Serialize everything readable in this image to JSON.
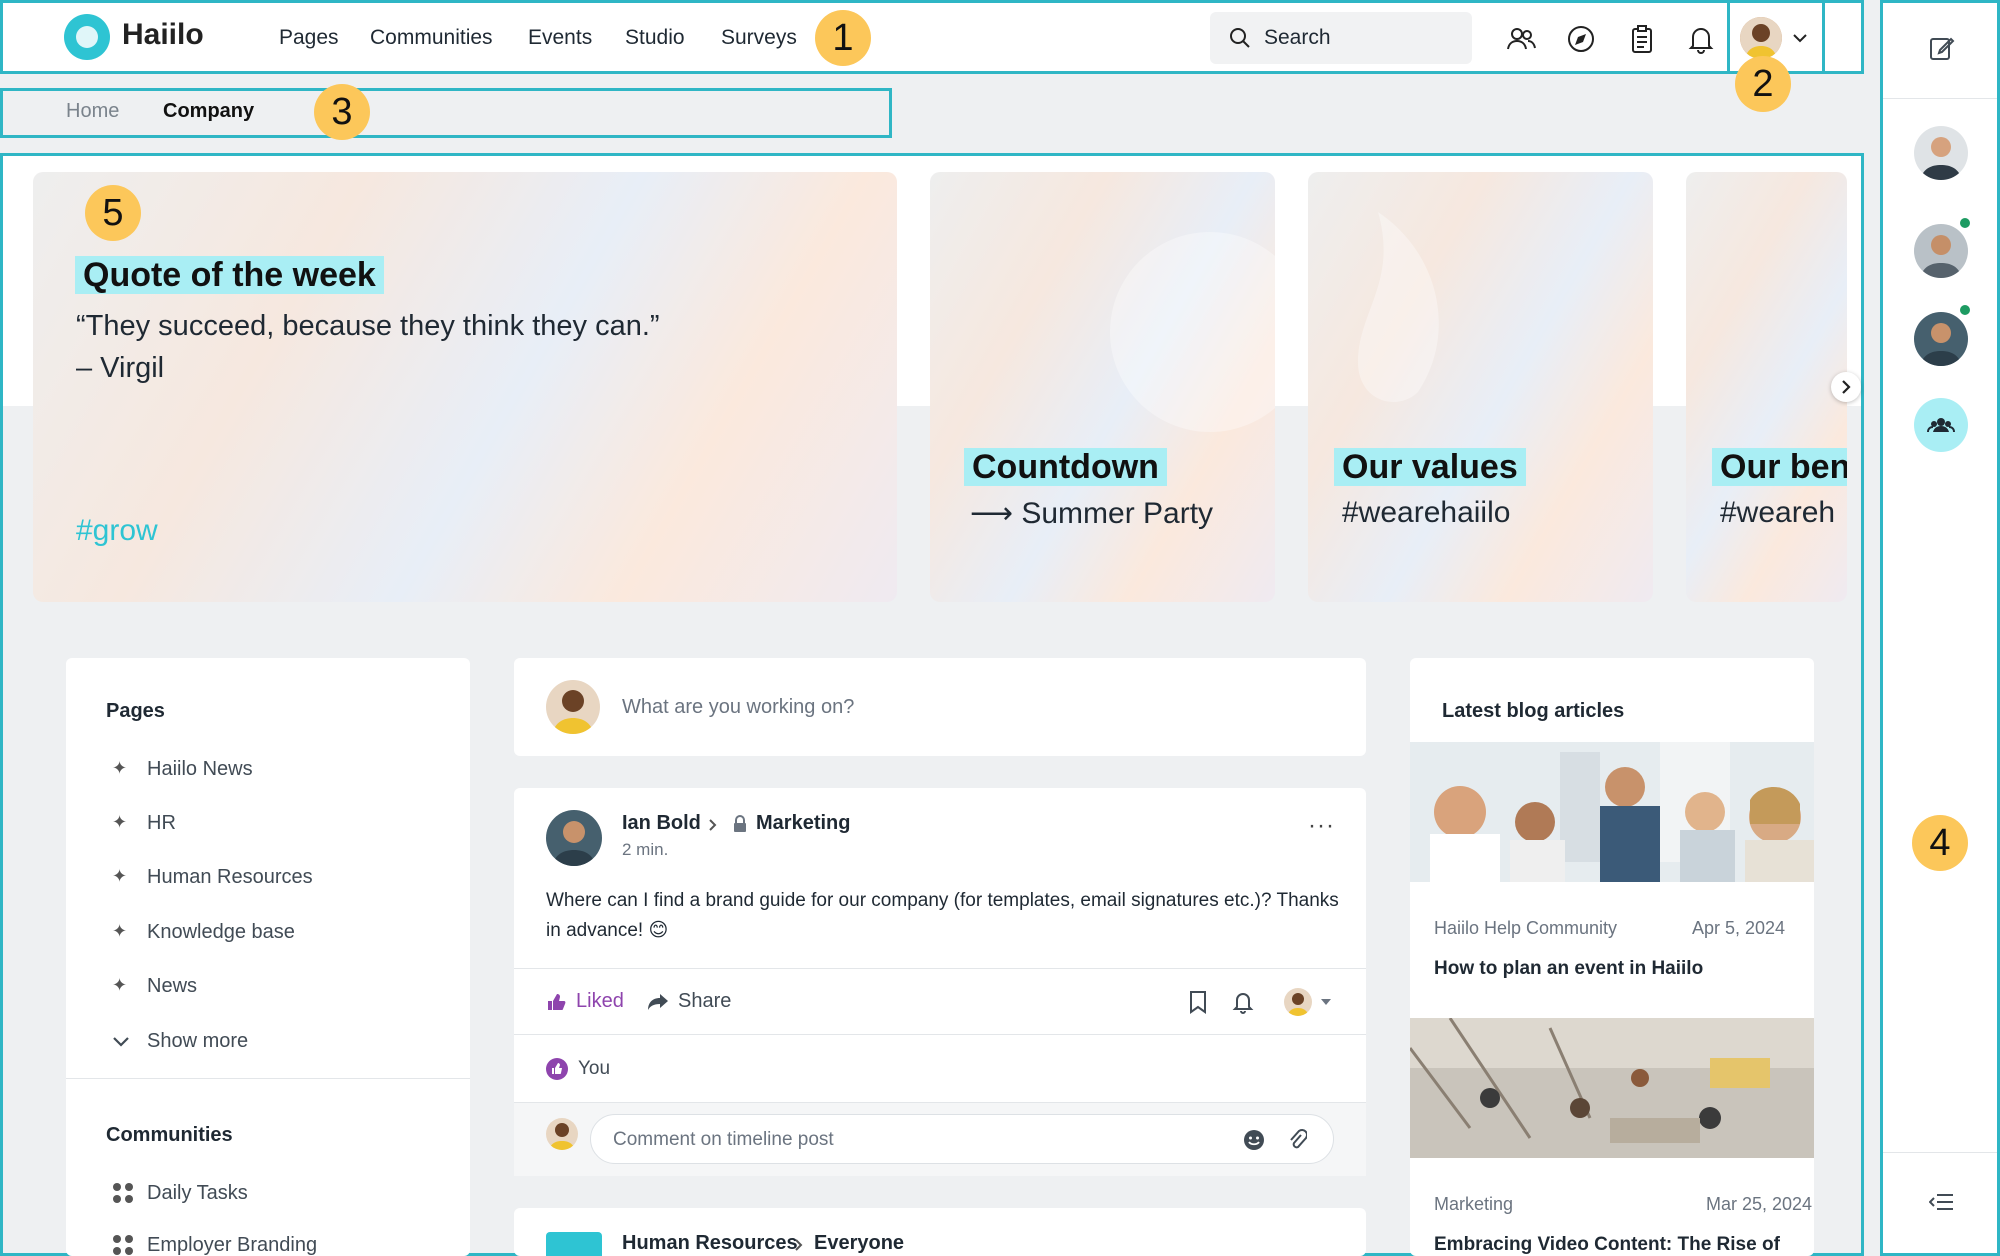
{
  "app": {
    "name": "Haiilo"
  },
  "nav": {
    "items": [
      "Pages",
      "Communities",
      "Events",
      "Studio",
      "Surveys"
    ]
  },
  "search": {
    "label": "Search"
  },
  "breadcrumb": {
    "home": "Home",
    "current": "Company"
  },
  "callouts": {
    "c1": "1",
    "c2": "2",
    "c3": "3",
    "c4": "4",
    "c5": "5"
  },
  "hero": {
    "quote": {
      "title": "Quote of the week",
      "text": "“They succeed, because they think they can.”",
      "author": "– Virgil",
      "tag": "#grow"
    },
    "countdown": {
      "title": "Countdown",
      "sub": "⟶ Summer Party"
    },
    "values": {
      "title": "Our values",
      "sub": "#wearehaiilo"
    },
    "benefits": {
      "title": "Our ben",
      "sub": "#weareh"
    }
  },
  "sidebar": {
    "pages_title": "Pages",
    "pages": [
      "Haiilo News",
      "HR",
      "Human Resources",
      "Knowledge base",
      "News"
    ],
    "show_more": "Show more",
    "communities_title": "Communities",
    "communities": [
      "Daily Tasks",
      "Employer Branding"
    ]
  },
  "composer": {
    "placeholder": "What are you working on?"
  },
  "post": {
    "author": "Ian Bold",
    "target": "Marketing",
    "time": "2 min.",
    "body": "Where can I find a brand guide for our company (for templates, email signatures etc.)? Thanks in advance! 😊",
    "liked_label": "Liked",
    "share_label": "Share",
    "likers": "You",
    "comment_placeholder": "Comment on timeline post"
  },
  "post2": {
    "author": "Human Resources",
    "target": "Everyone"
  },
  "blog": {
    "title": "Latest blog articles",
    "articles": [
      {
        "source": "Haiilo Help Community",
        "date": "Apr 5, 2024",
        "title": "How to plan an event in Haiilo"
      },
      {
        "source": "Marketing",
        "date": "Mar 25, 2024",
        "title": "Embracing Video Content: The Rise of"
      }
    ]
  },
  "colors": {
    "accent": "#2ec4d3",
    "callout": "#fcc75a",
    "liked": "#8e44ad",
    "online": "#1d9b62"
  }
}
